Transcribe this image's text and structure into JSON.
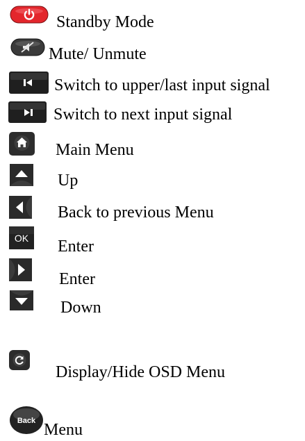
{
  "legend": {
    "items": [
      {
        "icon": "power-icon",
        "label": "Standby Mode"
      },
      {
        "icon": "mute-icon",
        "label": "Mute/ Unmute"
      },
      {
        "icon": "previous-input-icon",
        "label": "Switch to upper/last input signal"
      },
      {
        "icon": "next-input-icon",
        "label": "Switch to next input signal"
      },
      {
        "icon": "home-icon",
        "label": "Main Menu"
      },
      {
        "icon": "up-arrow-icon",
        "label": "Up"
      },
      {
        "icon": "left-arrow-icon",
        "label": "Back to previous Menu"
      },
      {
        "icon": "ok-icon",
        "label": "Enter",
        "icon_text": "OK"
      },
      {
        "icon": "right-arrow-icon",
        "label": "Enter"
      },
      {
        "icon": "down-arrow-icon",
        "label": "Down"
      },
      {
        "icon": "osd-icon",
        "label": "Display/Hide OSD Menu"
      },
      {
        "icon": "back-icon",
        "label": "Menu",
        "icon_text": "Back"
      }
    ]
  },
  "colors": {
    "power_red": "#e3262c",
    "icon_dark": "#1f1f1f",
    "text": "#000000"
  }
}
